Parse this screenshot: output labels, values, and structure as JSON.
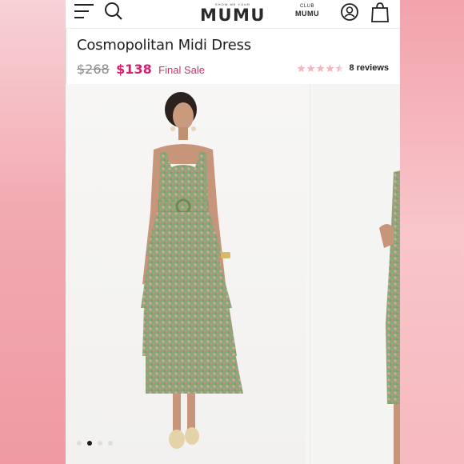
{
  "header": {
    "logo_tagline": "SHOW ME YOUR",
    "logo_text": "MUMU",
    "club_small": "CLUB",
    "club_big": "MUMU",
    "icons": [
      "menu-icon",
      "search-icon",
      "account-icon",
      "shopping-bag-icon"
    ]
  },
  "product": {
    "title": "Cosmopolitan Midi Dress",
    "original_price": "$268",
    "sale_price": "$138",
    "sale_note": "Final Sale",
    "rating": 4.5,
    "reviews_label": "8 reviews"
  },
  "gallery": {
    "image_count": 4,
    "active_index": 1
  },
  "colors": {
    "sale": "#d61f6b",
    "star": "#f2b8c0",
    "dress_green": "#7fa068",
    "dress_pink": "#d9a0a8"
  }
}
